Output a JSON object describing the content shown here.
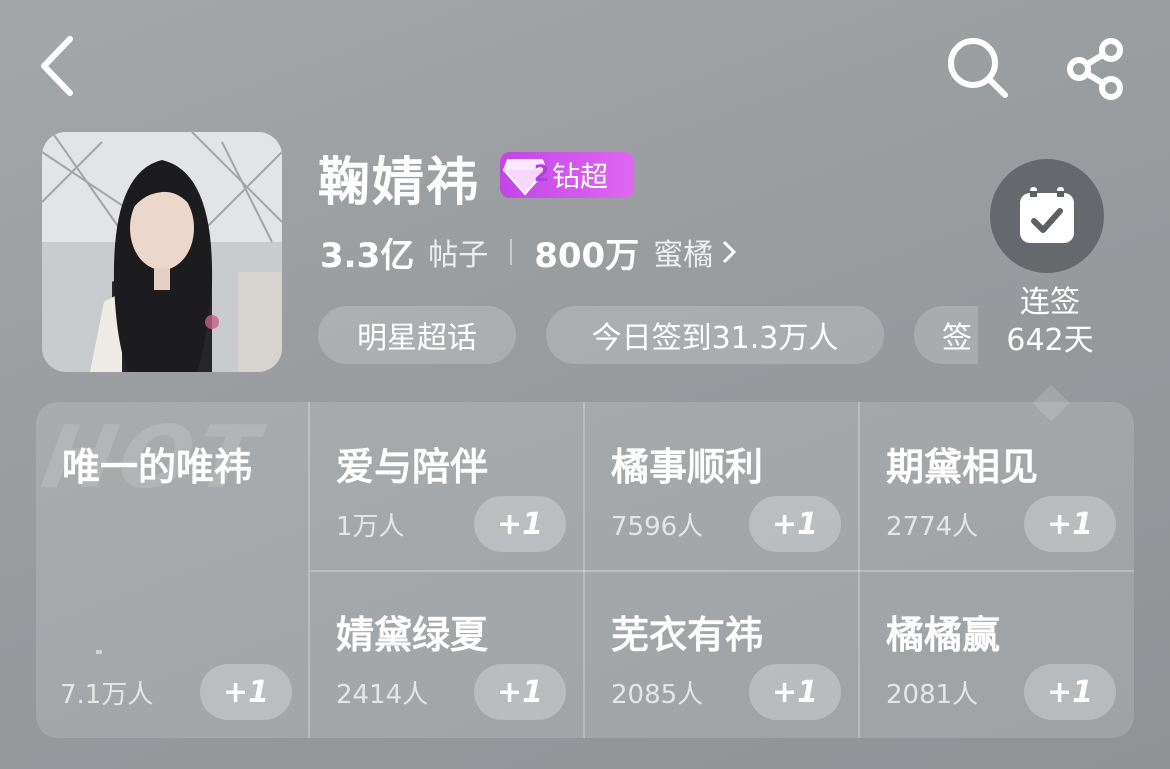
{
  "header": {
    "back_icon": "chevron-left-icon",
    "search_icon": "search-icon",
    "share_icon": "share-icon"
  },
  "profile": {
    "name": "鞠婧祎",
    "badge_level": "2",
    "badge_label": "钻超",
    "badge_color": "#d455ee",
    "posts_value": "3.3亿",
    "posts_label": "帖子",
    "fans_value": "800万",
    "fans_label": "蜜橘"
  },
  "tags": [
    "明星超话",
    "今日签到31.3万人",
    "签"
  ],
  "checkin": {
    "icon": "calendar-check-icon",
    "line1": "连签",
    "line2": "642天"
  },
  "hot": {
    "watermark": "HOT",
    "title": "唯一的唯祎",
    "count": "7.1万人",
    "button": "+1"
  },
  "groups": [
    {
      "name": "爱与陪伴",
      "count": "1万人",
      "button": "+1"
    },
    {
      "name": "橘事顺利",
      "count": "7596人",
      "button": "+1"
    },
    {
      "name": "期黛相见",
      "count": "2774人",
      "button": "+1"
    },
    {
      "name": "婧黛绿夏",
      "count": "2414人",
      "button": "+1"
    },
    {
      "name": "芜衣有祎",
      "count": "2085人",
      "button": "+1"
    },
    {
      "name": "橘橘赢",
      "count": "2081人",
      "button": "+1"
    }
  ]
}
